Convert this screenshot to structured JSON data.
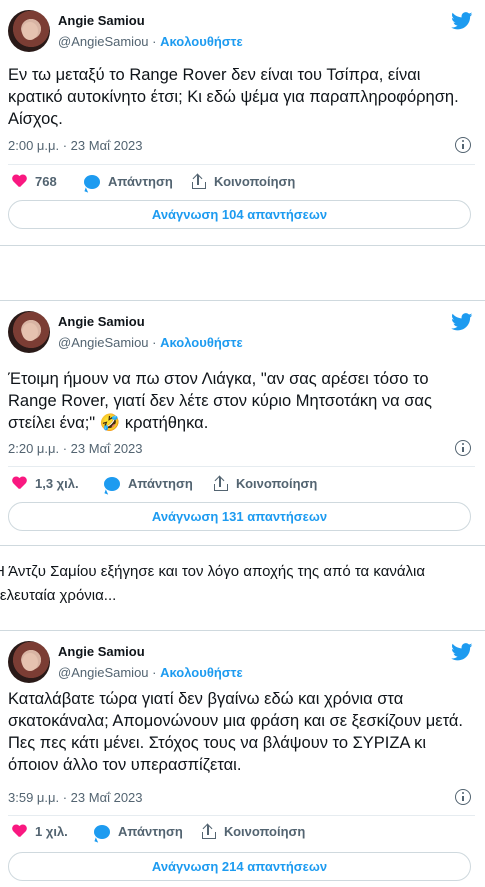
{
  "accent_color": "#1d9bf0",
  "like_color": "#f91880",
  "tweets": [
    {
      "author_name": "Angie Samiou",
      "handle": "@AngieSamiou",
      "follow_label": "Ακολουθήστε",
      "separator": " · ",
      "text": "Εν τω μεταξύ το Range Rover δεν είναι του Τσίπρα, είναι κρατικό αυτοκίνητο έτσι; Κι εδώ ψέμα για παραπληροφόρηση. Αίσχος.",
      "timestamp": "2:00 μ.μ. · 23 Μαΐ 2023",
      "likes": "768",
      "reply_label": "Απάντηση",
      "share_label": "Κοινοποίηση",
      "read_replies_label": "Ανάγνωση 104 απαντήσεων"
    },
    {
      "author_name": "Angie Samiou",
      "handle": "@AngieSamiou",
      "follow_label": "Ακολουθήστε",
      "separator": " · ",
      "text": "Έτοιμη ήμουν να πω στον Λιάγκα, \"αν σας αρέσει τόσο το  Range Rover, γιατί δεν λέτε στον κύριο Μητσοτάκη να σας στείλει ένα;\" 🤣 κρατήθηκα.",
      "timestamp": "2:20 μ.μ. · 23 Μαΐ 2023",
      "likes": "1,3 χιλ.",
      "reply_label": "Απάντηση",
      "share_label": "Κοινοποίηση",
      "read_replies_label": "Ανάγνωση 131 απαντήσεων"
    },
    {
      "author_name": "Angie Samiou",
      "handle": "@AngieSamiou",
      "follow_label": "Ακολουθήστε",
      "separator": " · ",
      "text": "Καταλάβατε τώρα γιατί δεν βγαίνω εδώ και χρόνια στα σκατοκάναλα; Απομονώνουν μια φράση και σε ξεσκίζουν μετά. Πες πες κάτι μένει. Στόχος τους να βλάψουν το ΣΥΡΙΖΑ κι όποιον άλλο τον υπερασπίζεται.",
      "timestamp": "3:59 μ.μ. · 23 Μαΐ 2023",
      "likes": "1 χιλ.",
      "reply_label": "Απάντηση",
      "share_label": "Κοινοποίηση",
      "read_replies_label": "Ανάγνωση 214 απαντήσεων"
    }
  ],
  "article": {
    "line1": "Η Άντζυ Σαμίου εξήγησε και τον λόγο αποχής της από τα κανάλια",
    "line2": "τελευταία χρόνια..."
  },
  "icons": [
    "twitter-bird-icon",
    "info-icon",
    "heart-icon",
    "reply-bubble-icon",
    "share-icon"
  ]
}
